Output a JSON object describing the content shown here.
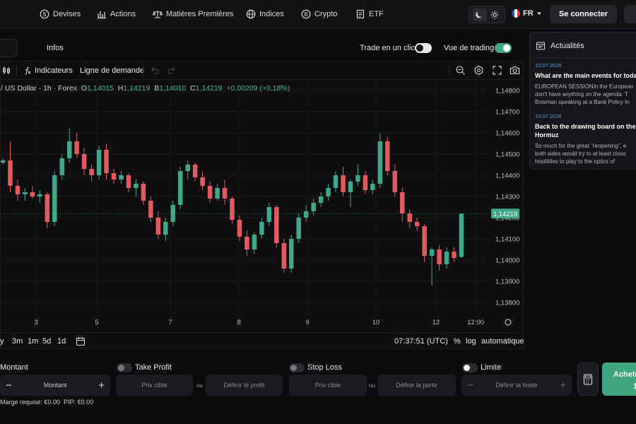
{
  "nav": {
    "items": [
      {
        "label": "Devises",
        "icon": "coin-dollar-icon"
      },
      {
        "label": "Actions",
        "icon": "bar-chart-icon"
      },
      {
        "label": "Matières Premières",
        "icon": "scale-icon"
      },
      {
        "label": "Indices",
        "icon": "globe-icon"
      },
      {
        "label": "Crypto",
        "icon": "bitcoin-icon"
      },
      {
        "label": "ETF",
        "icon": "document-icon"
      }
    ],
    "language": "FR",
    "login_label": "Se connecter"
  },
  "tabs": {
    "infos_label": "Infos",
    "one_click_label": "Trade en un clic",
    "one_click_on": false,
    "trading_view_label": "Vue de trading",
    "trading_view_on": true
  },
  "toolbar": {
    "indicators_label": "Indicateurs",
    "demand_line_label": "Ligne de demande"
  },
  "legend": {
    "symbol": "/ US Dollar · 1h · Forex",
    "o_label": "O",
    "o_value": "1,14015",
    "h_label": "H",
    "h_value": "1,14219",
    "l_label": "B",
    "l_value": "1,14010",
    "c_label": "C",
    "c_value": "1,14219",
    "change": "+0,00209 (+0,18%)"
  },
  "chart_data": {
    "type": "candlestick",
    "y_ticks": [
      "1,14800",
      "1,14700",
      "1,14600",
      "1,14500",
      "1,14400",
      "1,14300",
      "1,14200",
      "1,14100",
      "1,14000",
      "1,13900",
      "1,13800"
    ],
    "ylim": [
      1.1375,
      1.1485
    ],
    "x_ticks": [
      "3",
      "5",
      "7",
      "8",
      "9",
      "10",
      "12",
      "12:00"
    ],
    "current_price_label": "1,14219",
    "up_color": "#3fa888",
    "down_color": "#e25a5f",
    "candles": [
      [
        1.1446,
        1.1448,
        1.1445,
        1.1447
      ],
      [
        1.1447,
        1.1456,
        1.1432,
        1.1435
      ],
      [
        1.1435,
        1.1438,
        1.1428,
        1.1431
      ],
      [
        1.1431,
        1.1434,
        1.1428,
        1.1432
      ],
      [
        1.1432,
        1.1435,
        1.1429,
        1.143
      ],
      [
        1.143,
        1.1433,
        1.1427,
        1.1431
      ],
      [
        1.1431,
        1.1432,
        1.1415,
        1.1418
      ],
      [
        1.1418,
        1.1442,
        1.1416,
        1.144
      ],
      [
        1.144,
        1.145,
        1.1438,
        1.1448
      ],
      [
        1.1448,
        1.1462,
        1.1446,
        1.1456
      ],
      [
        1.1456,
        1.146,
        1.1448,
        1.145
      ],
      [
        1.145,
        1.1453,
        1.144,
        1.1443
      ],
      [
        1.1443,
        1.1445,
        1.1437,
        1.144
      ],
      [
        1.144,
        1.1454,
        1.1438,
        1.1452
      ],
      [
        1.1452,
        1.1455,
        1.1438,
        1.1441
      ],
      [
        1.1441,
        1.1443,
        1.1436,
        1.1438
      ],
      [
        1.1438,
        1.1442,
        1.1436,
        1.144
      ],
      [
        1.144,
        1.1441,
        1.1432,
        1.1434
      ],
      [
        1.1434,
        1.1438,
        1.143,
        1.1436
      ],
      [
        1.1436,
        1.1437,
        1.1426,
        1.1428
      ],
      [
        1.1428,
        1.143,
        1.1418,
        1.142
      ],
      [
        1.142,
        1.1423,
        1.141,
        1.1412
      ],
      [
        1.1412,
        1.142,
        1.1409,
        1.1418
      ],
      [
        1.1418,
        1.1428,
        1.1416,
        1.1426
      ],
      [
        1.1426,
        1.1444,
        1.1424,
        1.1442
      ],
      [
        1.1442,
        1.1447,
        1.1438,
        1.1445
      ],
      [
        1.1445,
        1.1446,
        1.1437,
        1.1439
      ],
      [
        1.1439,
        1.1442,
        1.1433,
        1.1435
      ],
      [
        1.1435,
        1.1437,
        1.1427,
        1.1429
      ],
      [
        1.1429,
        1.1436,
        1.1428,
        1.1434
      ],
      [
        1.1434,
        1.1438,
        1.1426,
        1.1429
      ],
      [
        1.1429,
        1.143,
        1.1417,
        1.1419
      ],
      [
        1.1419,
        1.1421,
        1.1409,
        1.1411
      ],
      [
        1.1411,
        1.1414,
        1.1402,
        1.1405
      ],
      [
        1.1405,
        1.1413,
        1.1403,
        1.1412
      ],
      [
        1.1412,
        1.142,
        1.141,
        1.1418
      ],
      [
        1.1418,
        1.1427,
        1.1416,
        1.1425
      ],
      [
        1.1425,
        1.1426,
        1.1406,
        1.1408
      ],
      [
        1.1408,
        1.141,
        1.1394,
        1.1396
      ],
      [
        1.1396,
        1.1412,
        1.1394,
        1.141
      ],
      [
        1.141,
        1.1422,
        1.1408,
        1.142
      ],
      [
        1.142,
        1.1426,
        1.1418,
        1.1423
      ],
      [
        1.1423,
        1.1429,
        1.1421,
        1.1427
      ],
      [
        1.1427,
        1.1432,
        1.1425,
        1.143
      ],
      [
        1.143,
        1.1436,
        1.1428,
        1.1434
      ],
      [
        1.1434,
        1.1442,
        1.1432,
        1.144
      ],
      [
        1.144,
        1.1444,
        1.143,
        1.1432
      ],
      [
        1.1432,
        1.1438,
        1.1425,
        1.1437
      ],
      [
        1.1437,
        1.1445,
        1.1435,
        1.144
      ],
      [
        1.144,
        1.1442,
        1.1431,
        1.1433
      ],
      [
        1.1433,
        1.1438,
        1.1431,
        1.1436
      ],
      [
        1.1436,
        1.146,
        1.1434,
        1.1456
      ],
      [
        1.1456,
        1.1458,
        1.144,
        1.1442
      ],
      [
        1.1442,
        1.1445,
        1.143,
        1.1432
      ],
      [
        1.1432,
        1.1434,
        1.1418,
        1.1422
      ],
      [
        1.1422,
        1.1424,
        1.1415,
        1.1418
      ],
      [
        1.1418,
        1.142,
        1.1414,
        1.1416
      ],
      [
        1.1416,
        1.1417,
        1.1399,
        1.1402
      ],
      [
        1.1402,
        1.1406,
        1.1388,
        1.1405
      ],
      [
        1.1405,
        1.1407,
        1.1395,
        1.1398
      ],
      [
        1.1398,
        1.1406,
        1.1396,
        1.1404
      ],
      [
        1.1404,
        1.1406,
        1.1399,
        1.1401
      ],
      [
        1.14015,
        1.14219,
        1.1401,
        1.14219
      ]
    ]
  },
  "bottom_bar": {
    "ranges": [
      "y",
      "3m",
      "1m",
      "5d",
      "1d"
    ],
    "time": "07:37:51 (UTC)",
    "pct": "%",
    "log": "log",
    "auto": "automatique"
  },
  "news": {
    "title": "Actualités",
    "items": [
      {
        "date": "13.07.2026",
        "title": "What are the main events for toda",
        "body": [
          "EUROPEAN SESSIONIn the European",
          "don't have anything on the agenda. T",
          "Bowman speaking at a Bank Policy In"
        ]
      },
      {
        "date": "13.07.2026",
        "title": "Back to the drawing board on the",
        "title2": "Hormuz",
        "body": [
          "So much for the great \"reopening\", e",
          "both sides would try to at least close",
          "hostilities to play to the optics of"
        ]
      }
    ]
  },
  "order": {
    "amount_label": "Montant",
    "amount_placeholder": "Montant",
    "take_profit_label": "Take Profit",
    "stop_loss_label": "Stop Loss",
    "limit_label": "Limite",
    "target_price": "Prix cible",
    "or": "ou",
    "set_profit": "Définir le profit",
    "set_loss": "Définir la perte",
    "set_limit": "Définir la limite",
    "margin_label": "Marge requise: €0.00",
    "pip_label": "PIP: €0.00",
    "buy_label": "Achete",
    "buy_sub": "1"
  }
}
